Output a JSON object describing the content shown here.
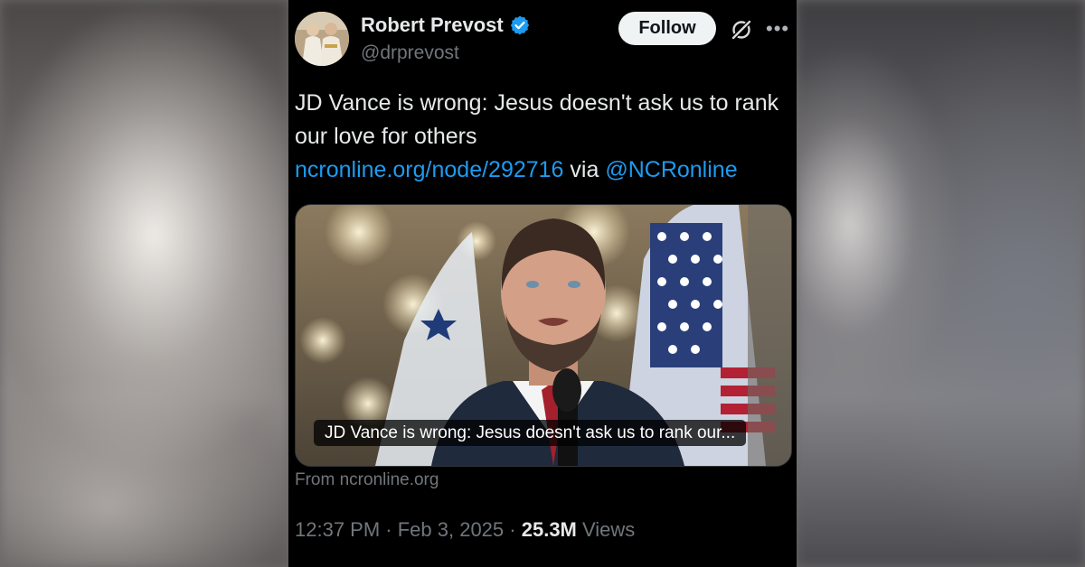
{
  "account": {
    "name": "Robert Prevost",
    "handle": "@drprevost",
    "verified": true
  },
  "actions": {
    "follow_label": "Follow",
    "grok_icon": "grok-icon",
    "more_icon": "more-icon"
  },
  "tweet": {
    "text_line1": "JD Vance is wrong: Jesus doesn't ask us to rank our love for others",
    "link_text": "ncronline.org/node/292716",
    "via_text": " via ",
    "mention": "@NCRonline"
  },
  "card": {
    "caption": "JD Vance is wrong: Jesus doesn't ask us to rank our...",
    "source": "From ncronline.org"
  },
  "meta": {
    "time": "12:37 PM",
    "separator": " · ",
    "date": "Feb 3, 2025",
    "views_count": "25.3M",
    "views_label": " Views"
  },
  "colors": {
    "accent_link": "#1d9bf0",
    "verified_badge": "#1d9bf0",
    "background": "#000000",
    "text_primary": "#e7e9ea",
    "text_secondary": "#71767b"
  }
}
